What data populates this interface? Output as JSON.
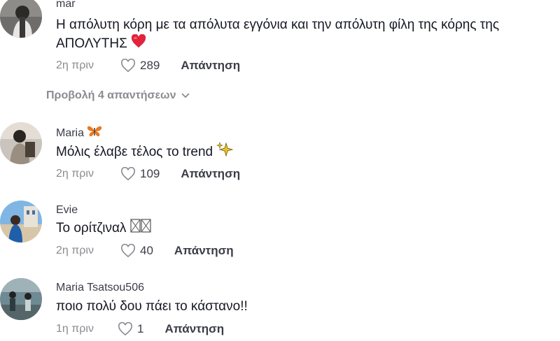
{
  "comments": [
    {
      "username": "mar",
      "text": "Η απόλυτη κόρη με τα απόλυτα εγγόνια και την απόλυτη φίλη της κόρης της ΑΠΟΛΥΤΗΣ",
      "emoji": "red-heart-icon",
      "time": "2η πριν",
      "likes": "289",
      "reply_label": "Απάντηση"
    },
    {
      "username": "Maria",
      "username_emoji": "butterfly-icon",
      "text": "Μόλις έλαβε τέλος το trend",
      "emoji": "sparkles-icon",
      "time": "2η πριν",
      "likes": "109",
      "reply_label": "Απάντηση"
    },
    {
      "username": "Evie",
      "text": "Το ορίτζιναλ",
      "emoji": "missing-glyph-icon",
      "time": "2η πριν",
      "likes": "40",
      "reply_label": "Απάντηση"
    },
    {
      "username": "Maria Tsatsou506",
      "text": "ποιο πολύ δου πάει το κάστανο!!",
      "time": "1η πριν",
      "likes": "1",
      "reply_label": "Απάντηση"
    }
  ],
  "view_replies": {
    "label": "Προβολή 4 απαντήσεων",
    "icon": "chevron-down-icon"
  },
  "colors": {
    "text": "#161823",
    "muted": "#8a8b91",
    "heart": "#e8344a"
  }
}
